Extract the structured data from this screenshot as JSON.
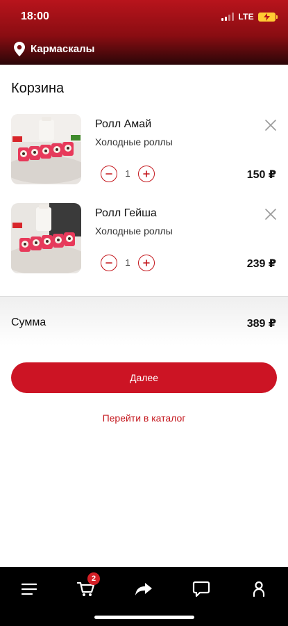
{
  "status_bar": {
    "time": "18:00",
    "network": "LTE"
  },
  "header": {
    "location": "Кармаскалы",
    "icon": "location-pin-icon"
  },
  "page": {
    "title": "Корзина"
  },
  "cart": {
    "items": [
      {
        "name": "Ролл Амай",
        "category": "Холодные роллы",
        "quantity": "1",
        "price": "150 ₽"
      },
      {
        "name": "Ролл Гейша",
        "category": "Холодные роллы",
        "quantity": "1",
        "price": "239 ₽"
      }
    ]
  },
  "summary": {
    "label": "Сумма",
    "value": "389 ₽"
  },
  "actions": {
    "next": "Далее",
    "catalog": "Перейти в каталог"
  },
  "tabbar": {
    "cart_badge": "2",
    "icons": [
      "menu-icon",
      "cart-icon",
      "share-icon",
      "chat-icon",
      "profile-icon"
    ]
  },
  "colors": {
    "accent": "#cc1424",
    "header_top": "#b8141c",
    "tabbar": "#000000"
  }
}
